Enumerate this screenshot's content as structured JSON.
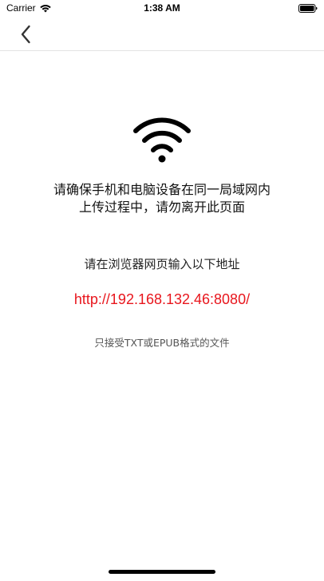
{
  "status_bar": {
    "carrier": "Carrier",
    "time": "1:38 AM",
    "icons": [
      "wifi-signal-icon",
      "battery-icon"
    ]
  },
  "nav": {
    "back_icon": "chevron-left-icon"
  },
  "main": {
    "icon": "wifi-icon",
    "instruction_line1": "请确保手机和电脑设备在同一局域网内",
    "instruction_line2": "上传过程中，请勿离开此页面",
    "browser_hint": "请在浏览器网页输入以下地址",
    "url": "http://192.168.132.46:8080/",
    "format_note": "只接受TXT或EPUB格式的文件"
  },
  "colors": {
    "accent_url": "#e8161d",
    "text_primary": "#111111",
    "text_secondary": "#555555"
  }
}
